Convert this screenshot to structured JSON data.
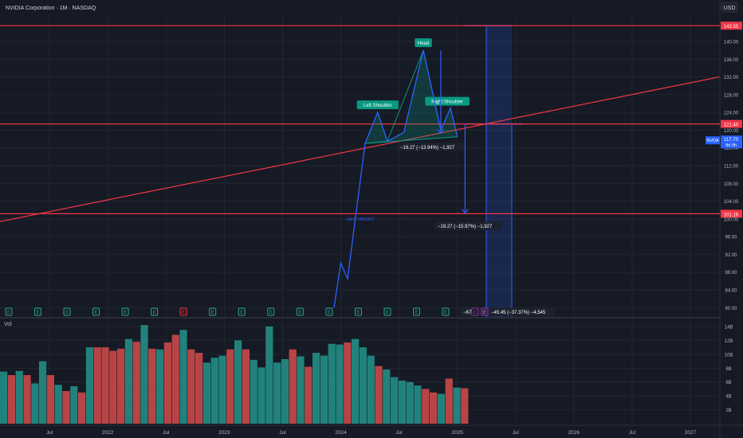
{
  "symbol_title": "NVIDIA Corporation · 1M · NASDAQ",
  "currency": "USD",
  "volume_label": "Vol",
  "price_axis": {
    "ticks": [
      80,
      84,
      88,
      92,
      96,
      100,
      104,
      108,
      112,
      116,
      120,
      124,
      128,
      132,
      136,
      140
    ],
    "tick_labels": [
      "80.00",
      "84.00",
      "88.00",
      "92.00",
      "96.00",
      "100.00",
      "104.00",
      "108.00",
      "112.00",
      "116.00",
      "120.00",
      "124.00",
      "128.00",
      "132.00",
      "136.00",
      "140.00"
    ],
    "range": [
      77.9,
      146.1
    ]
  },
  "volume_axis": {
    "ticks": [
      2,
      4,
      6,
      8,
      10,
      12,
      14
    ],
    "tick_labels": [
      "2B",
      "4B",
      "6B",
      "8B",
      "10B",
      "12B",
      "14B"
    ],
    "range": [
      0,
      14.8
    ]
  },
  "time_axis": {
    "labels": [
      "Jul",
      "2022",
      "Jul",
      "2023",
      "Jul",
      "2024",
      "Jul",
      "2025",
      "Jul",
      "2026",
      "Jul",
      "2027"
    ],
    "months_from_start": [
      6,
      12,
      18,
      24,
      30,
      36,
      42,
      48,
      54,
      60,
      66,
      72
    ]
  },
  "horizontal_levels": [
    {
      "price": 143.55,
      "label": "143.55",
      "color": "#f23645"
    },
    {
      "price": 121.4,
      "label": "121.40",
      "color": "#f23645"
    },
    {
      "price": 101.16,
      "label": "101.16",
      "color": "#f23645"
    }
  ],
  "current_price": {
    "symbol": "NVDA",
    "price": 117.7,
    "label": "117.70",
    "countdown": "8d 0h",
    "color": "#2962ff"
  },
  "trendline": {
    "from": {
      "month": 0,
      "price": 99.0
    },
    "to": {
      "month": 75,
      "price": 132.0
    },
    "color": "#f23645"
  },
  "pattern": {
    "labels": {
      "left_shoulder": "Left Shoulder",
      "head": "Head",
      "right_shoulder": "Right Shoulder"
    },
    "points": [
      {
        "month": 38.5,
        "price": 117.0
      },
      {
        "month": 39.8,
        "price": 124.0
      },
      {
        "month": 40.8,
        "price": 117.5
      },
      {
        "month": 42.5,
        "price": 119.5
      },
      {
        "month": 44.5,
        "price": 138.0
      },
      {
        "month": 46.3,
        "price": 120.0
      },
      {
        "month": 47.3,
        "price": 125.0
      },
      {
        "month": 48.0,
        "price": 118.5
      }
    ]
  },
  "price_line": [
    {
      "month": 35.3,
      "price": 80.0
    },
    {
      "month": 36.0,
      "price": 90.0
    },
    {
      "month": 36.7,
      "price": 86.5
    },
    {
      "month": 38.5,
      "price": 117.0
    },
    {
      "month": 39.8,
      "price": 124.0
    },
    {
      "month": 40.8,
      "price": 117.5
    },
    {
      "month": 42.5,
      "price": 119.5
    },
    {
      "month": 44.5,
      "price": 138.0
    },
    {
      "month": 46.3,
      "price": 120.0
    },
    {
      "month": 47.3,
      "price": 125.0
    },
    {
      "month": 48.0,
      "price": 118.5
    }
  ],
  "measures": [
    {
      "text": "−19.27 (−13.94%) −1,927"
    },
    {
      "text": "−19.27 (−15.97%) −1,927"
    },
    {
      "text": "−67.16"
    },
    {
      "text": "−45.45 (−37.37%) −4,545"
    }
  ],
  "neckline_label": "H&S TARGET",
  "earnings_marker": "E",
  "earnings": [
    {
      "month": 1.8,
      "type": "positive"
    },
    {
      "month": 4.8,
      "type": "positive"
    },
    {
      "month": 7.8,
      "type": "positive"
    },
    {
      "month": 10.8,
      "type": "positive"
    },
    {
      "month": 13.8,
      "type": "positive"
    },
    {
      "month": 16.8,
      "type": "positive"
    },
    {
      "month": 19.8,
      "type": "negative"
    },
    {
      "month": 22.8,
      "type": "positive"
    },
    {
      "month": 25.8,
      "type": "positive"
    },
    {
      "month": 28.8,
      "type": "positive"
    },
    {
      "month": 31.8,
      "type": "positive"
    },
    {
      "month": 34.8,
      "type": "positive"
    },
    {
      "month": 37.8,
      "type": "positive"
    },
    {
      "month": 40.8,
      "type": "positive"
    },
    {
      "month": 43.8,
      "type": "positive"
    },
    {
      "month": 46.8,
      "type": "positive"
    },
    {
      "month": 49.8,
      "type": "purple"
    }
  ],
  "chart_data": {
    "type": "bar",
    "title": "Vol",
    "unit": "B",
    "ylim": [
      0,
      14.8
    ],
    "series": [
      {
        "name": "Vol",
        "values": [
          7.5,
          7.0,
          7.6,
          7.0,
          5.8,
          9.0,
          7.0,
          5.6,
          4.7,
          5.4,
          4.5,
          11.0,
          11.0,
          11.0,
          10.5,
          10.8,
          12.2,
          11.8,
          14.2,
          10.8,
          10.7,
          11.7,
          12.8,
          13.5,
          10.7,
          10.2,
          8.8,
          9.5,
          9.8,
          10.7,
          12.0,
          10.7,
          9.2,
          8.1,
          14.0,
          8.8,
          9.3,
          10.7,
          9.7,
          8.2,
          10.2,
          9.8,
          11.5,
          11.4,
          11.7,
          12.2,
          11.0,
          9.8,
          8.3,
          7.8,
          6.7,
          6.2,
          6.0,
          5.5,
          5.0,
          4.5,
          4.3,
          6.5,
          5.2,
          5.1
        ],
        "direction": [
          "up",
          "down",
          "up",
          "down",
          "up",
          "up",
          "down",
          "up",
          "down",
          "up",
          "down",
          "up",
          "down",
          "down",
          "down",
          "down",
          "up",
          "down",
          "up",
          "down",
          "up",
          "down",
          "down",
          "up",
          "down",
          "down",
          "up",
          "up",
          "up",
          "down",
          "up",
          "down",
          "up",
          "up",
          "up",
          "up",
          "up",
          "down",
          "up",
          "down",
          "up",
          "up",
          "up",
          "up",
          "down",
          "up",
          "up",
          "up",
          "down",
          "up",
          "up",
          "up",
          "up",
          "up",
          "down",
          "down",
          "up",
          "down",
          "up",
          "down"
        ]
      }
    ],
    "grid": true
  },
  "colors": {
    "up": "#26a69a",
    "down": "#ef5350",
    "bg": "#161a25",
    "grid": "#222632",
    "accent": "#2962ff",
    "pattern": "#089981"
  }
}
